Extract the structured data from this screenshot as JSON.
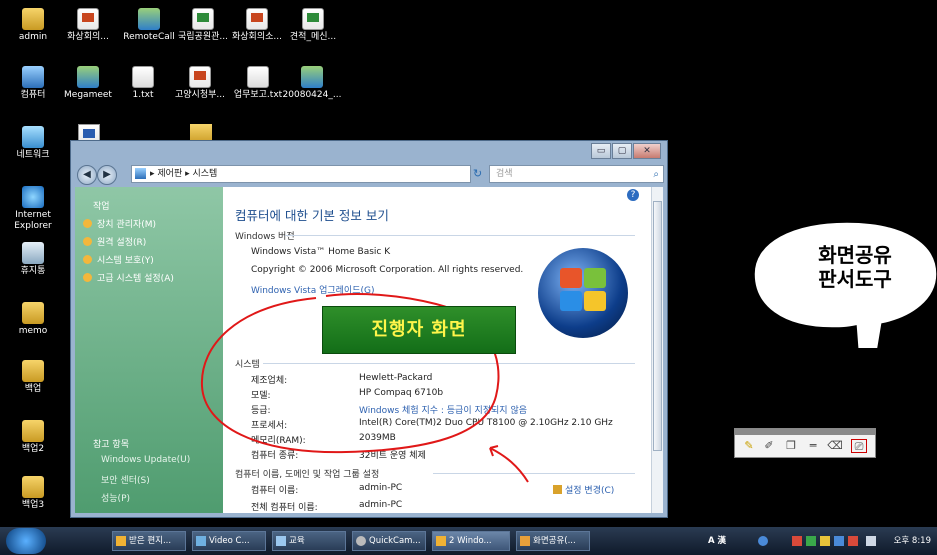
{
  "desktop": {
    "icons": [
      {
        "label": "admin",
        "icon": "folder-icon"
      },
      {
        "label": "화상회의...",
        "icon": "document-icon"
      },
      {
        "label": "RemoteCall",
        "icon": "remotecall-icon"
      },
      {
        "label": "국립공원관...",
        "icon": "spreadsheet-icon"
      },
      {
        "label": "화상회의소...",
        "icon": "presentation-icon"
      },
      {
        "label": "견적_메신...",
        "icon": "spreadsheet-icon"
      },
      {
        "label": "컴퓨터",
        "icon": "computer-icon"
      },
      {
        "label": "Megameet",
        "icon": "megameet-icon"
      },
      {
        "label": "1.txt",
        "icon": "text-file-icon"
      },
      {
        "label": "고양시청부...",
        "icon": "presentation-icon"
      },
      {
        "label": "업무보고.txt",
        "icon": "text-file-icon"
      },
      {
        "label": "20080424_...",
        "icon": "installer-icon"
      },
      {
        "label": "네트워크",
        "icon": "network-icon"
      },
      {
        "label": "Internet Explorer",
        "icon": "internet-explorer-icon"
      },
      {
        "label": "휴지통",
        "icon": "recycle-bin-icon"
      },
      {
        "label": "memo",
        "icon": "folder-icon"
      },
      {
        "label": "백업",
        "icon": "folder-icon"
      },
      {
        "label": "백업2",
        "icon": "folder-icon"
      },
      {
        "label": "백업3",
        "icon": "folder-icon"
      }
    ]
  },
  "window": {
    "title_buttons": {
      "minimize": "▭",
      "maximize": "▢",
      "close": "✕"
    },
    "breadcrumb": "▸ 제어판 ▸ 시스템",
    "search_placeholder": "검색",
    "sidebar": {
      "tasks_title": "작업",
      "tasks": [
        "장치 관리자(M)",
        "원격 설정(R)",
        "시스템 보호(Y)",
        "고급 시스템 설정(A)"
      ],
      "see_also_title": "참고 항목",
      "see_also": [
        "Windows Update(U)",
        "보안 센터(S)",
        "성능(P)"
      ]
    },
    "main": {
      "heading": "컴퓨터에 대한 기본 정보 보기",
      "windows_edition_section": "Windows 버전",
      "edition": "Windows Vista™ Home Basic K",
      "copyright": "Copyright © 2006 Microsoft Corporation.  All rights reserved.",
      "upgrade_link": "Windows Vista 업그레이드(G)",
      "system_section": "시스템",
      "system_rows": [
        {
          "label": "제조업체:",
          "value": "Hewlett-Packard"
        },
        {
          "label": "모델:",
          "value": "HP Compaq 6710b"
        },
        {
          "label": "등급:",
          "value": "Windows 체험 지수 : 등급이 지정되지 않음"
        },
        {
          "label": "프로세서:",
          "value": "Intel(R) Core(TM)2 Duo CPU     T8100  @ 2.10GHz   2.10 GHz"
        },
        {
          "label": "메모리(RAM):",
          "value": "2039MB"
        },
        {
          "label": "컴퓨터 종류:",
          "value": "32비트 운영 체제"
        }
      ],
      "computer_section": "컴퓨터 이름, 도메인 및 작업 그룹 설정",
      "computer_rows": [
        {
          "label": "컴퓨터 이름:",
          "value": "admin-PC"
        },
        {
          "label": "전체 컴퓨터 이름:",
          "value": "admin-PC"
        }
      ],
      "change_settings_link": "설정 변경(C)"
    }
  },
  "overlay": {
    "presenter_label": "진행자 화면",
    "bubble_text": "화면공유\n판서도구",
    "bubble_line1": "화면공유",
    "bubble_line2": "판서도구",
    "annotation_tools": [
      "pen-icon",
      "highlighter-icon",
      "copy-icon",
      "line-icon",
      "eraser-icon",
      "clear-icon"
    ]
  },
  "taskbar": {
    "items": [
      {
        "label": "받은 편지...",
        "icon": "mail-icon"
      },
      {
        "label": "Video C...",
        "icon": "video-icon"
      },
      {
        "label": "교육",
        "icon": "education-icon"
      },
      {
        "label": "QuickCam...",
        "icon": "quickcam-icon"
      },
      {
        "label": "2 Windo...",
        "icon": "folder-icon"
      },
      {
        "label": "화면공유(...",
        "icon": "screen-share-icon"
      }
    ],
    "ime": "A 漢",
    "clock": "오후 8:19"
  },
  "colors": {
    "sidebar_green": "#4f9c6f",
    "heading_blue": "#1f4f8f",
    "presenter_box": "#1f7f1f",
    "presenter_text": "#fff54a",
    "annotation_red": "#e01818"
  }
}
